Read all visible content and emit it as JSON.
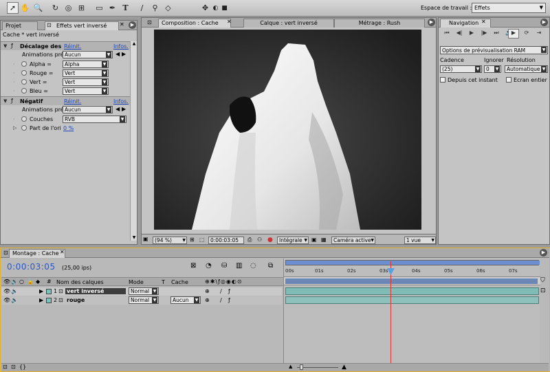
{
  "toolbar": {
    "tools": [
      "selection-tool",
      "hand-tool",
      "zoom-tool",
      "rotation-tool",
      "orbit-camera-tool",
      "pan-behind-tool",
      "rectangle-mask-tool",
      "pen-tool",
      "text-tool",
      "brush-tool",
      "clone-stamp-tool",
      "eraser-tool"
    ],
    "workspace_label": "Espace de travail :",
    "workspace_value": "Effets"
  },
  "effects_panel": {
    "tabs": [
      "Projet",
      "Effets vert inversé"
    ],
    "header": "Cache * vert inversé",
    "effect1": {
      "name": "Décalage des",
      "reset": "Réinit.",
      "info": "Infos.",
      "animations_label": "Animations pré",
      "animations_value": "Aucun",
      "params": [
        {
          "label": "Alpha =",
          "value": "Alpha"
        },
        {
          "label": "Rouge =",
          "value": "Vert"
        },
        {
          "label": "Vert =",
          "value": "Vert"
        },
        {
          "label": "Bleu =",
          "value": "Vert"
        }
      ]
    },
    "effect2": {
      "name": "Négatif",
      "reset": "Réinit.",
      "info": "Infos.",
      "animations_label": "Animations pré",
      "animations_value": "Aucun",
      "channels_label": "Couches",
      "channels_value": "RVB",
      "blend_label": "Part de l'ori",
      "blend_value": "0 %"
    }
  },
  "viewer": {
    "tabs": [
      "Composition : Cache",
      "Calque : vert inversé",
      "Métrage : Rush"
    ],
    "zoom": "(94 %)",
    "timecode": "0:00:03:05",
    "resolution": "Intégrale",
    "camera": "Caméra active",
    "views": "1 vue"
  },
  "navigation": {
    "tab": "Navigation",
    "ram_options": "Options de prévisualisation RAM",
    "cadence_label": "Cadence",
    "ignore_label": "Ignorer",
    "resolution_label": "Résolution",
    "cadence_value": "(25)",
    "ignore_value": "0",
    "resolution_value": "Automatique",
    "from_current": "Depuis cet instant",
    "full_screen": "Ecran entier"
  },
  "timeline": {
    "tab": "Montage : Cache",
    "timecode": "0:00:03:05",
    "fps": "(25,00 ips)",
    "headers": {
      "layer_name": "Nom des calques",
      "mode": "Mode",
      "t": "T",
      "matte": "Cache"
    },
    "layers": [
      {
        "number": "1",
        "name": "vert inversé",
        "mode": "Normal",
        "matte": ""
      },
      {
        "number": "2",
        "name": "rouge",
        "mode": "Normal",
        "matte": "Aucun"
      }
    ],
    "ruler": [
      "00s",
      "01s",
      "02s",
      "03s",
      "04s",
      "05s",
      "06s",
      "07s"
    ]
  }
}
